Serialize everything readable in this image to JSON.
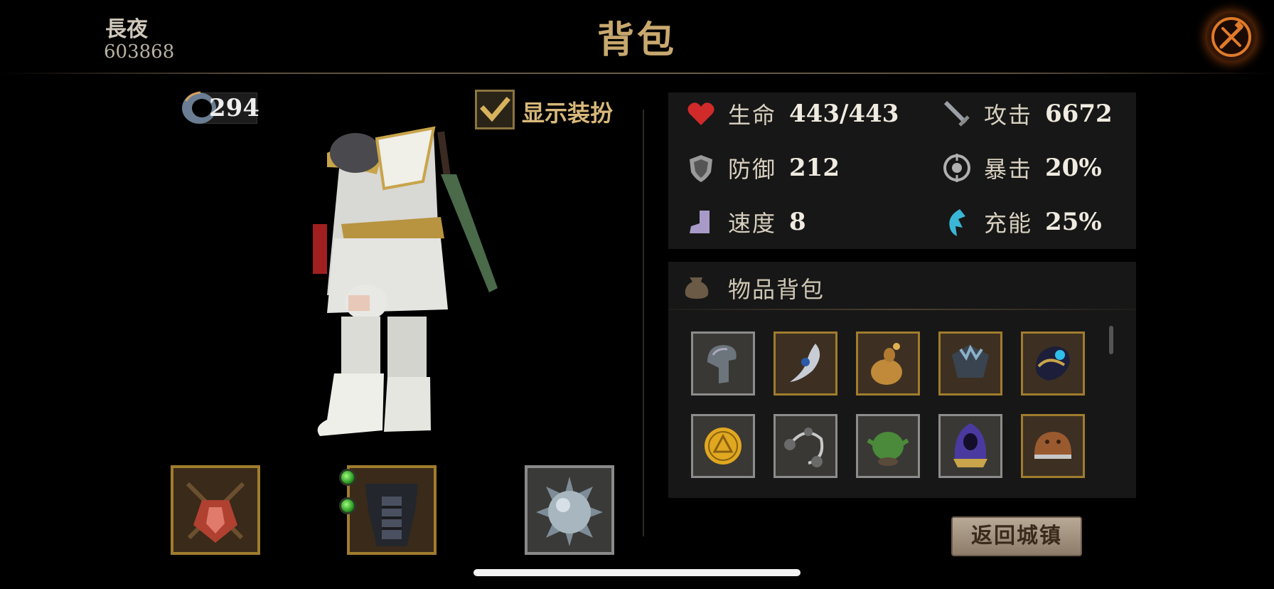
{
  "player": {
    "name": "長夜",
    "id": "603868"
  },
  "header": {
    "title": "背包"
  },
  "currency": {
    "value": "294",
    "icon": "ring-icon"
  },
  "costume": {
    "label": "显示装扮",
    "checked": true
  },
  "stats": [
    {
      "icon": "heart-icon",
      "label": "生命",
      "value": "443/443"
    },
    {
      "icon": "sword-icon",
      "label": "攻击",
      "value": "6672"
    },
    {
      "icon": "shield-icon",
      "label": "防御",
      "value": "212"
    },
    {
      "icon": "crit-icon",
      "label": "暴击",
      "value": "20%"
    },
    {
      "icon": "boot-icon",
      "label": "速度",
      "value": "8"
    },
    {
      "icon": "energy-icon",
      "label": "充能",
      "value": "25%"
    }
  ],
  "bag": {
    "title": "物品背包",
    "items": [
      {
        "name": "helmet-icon"
      },
      {
        "name": "pendant-icon"
      },
      {
        "name": "potion-gourd-icon"
      },
      {
        "name": "pauldron-icon"
      },
      {
        "name": "gem-amulet-icon"
      },
      {
        "name": "gold-coin-icon"
      },
      {
        "name": "spiked-flail-icon"
      },
      {
        "name": "goblin-mask-icon"
      },
      {
        "name": "purple-hood-icon"
      },
      {
        "name": "leather-cap-icon"
      }
    ]
  },
  "equipment": [
    {
      "name": "weapon-slot-icon"
    },
    {
      "name": "chest-armor-slot-icon"
    },
    {
      "name": "spiked-ball-slot-icon"
    }
  ],
  "return_button": {
    "label": "返回城镇"
  },
  "colors": {
    "gold_border": "#a07c2e",
    "accent": "#c8a86e",
    "background": "#000000"
  }
}
